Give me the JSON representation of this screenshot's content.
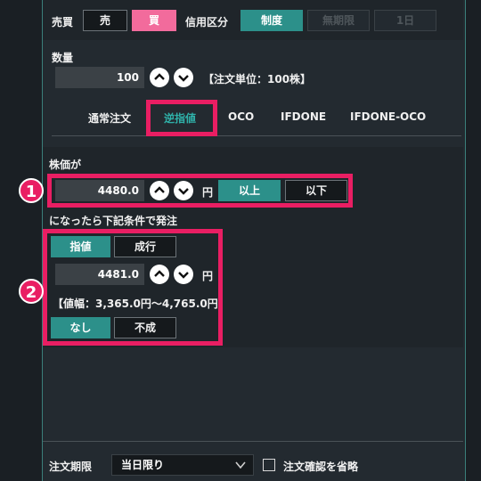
{
  "trade_type": {
    "label": "売買",
    "sell": "売",
    "buy": "買"
  },
  "credit": {
    "label": "信用区分",
    "standard": "制度",
    "unlimited": "無期限",
    "one_day": "1日"
  },
  "quantity": {
    "label": "数量",
    "value": "100",
    "unit_note": "【注文単位：100株】"
  },
  "order_tabs": [
    "通常注文",
    "逆指値",
    "OCO",
    "IFDONE",
    "IFDONE-OCO"
  ],
  "trigger": {
    "label": "株価が",
    "price": "4480.0",
    "yen": "円",
    "above": "以上",
    "below": "以下"
  },
  "condition_text": "になったら下記条件で発注",
  "order_type": {
    "limit": "指値",
    "market": "成行"
  },
  "limit_price": {
    "value": "4481.0",
    "yen": "円",
    "range": "【値幅：3,365.0円～4,765.0円】"
  },
  "execution": {
    "none": "なし",
    "funari": "不成"
  },
  "markers": {
    "one": "1",
    "two": "2"
  },
  "footer": {
    "period_label": "注文期限",
    "period_value": "当日限り",
    "skip_confirm": "注文確認を省略"
  },
  "colors": {
    "accent_teal": "#2c908a",
    "buy_pink": "#f26b9c",
    "highlight": "#e91e63"
  },
  "icons": {
    "up": "chevron-up-circle-icon",
    "down": "chevron-down-circle-icon",
    "dropdown": "chevron-down-icon"
  }
}
